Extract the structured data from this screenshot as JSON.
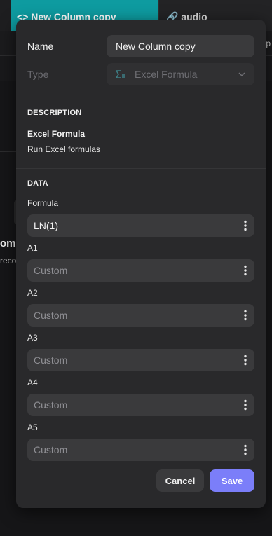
{
  "background": {
    "active_tab": "New Column copy",
    "second_tab": "audio",
    "row_edge_text": "p",
    "peek_title": "om",
    "peek_subtitle": "reco"
  },
  "dialog": {
    "name_label": "Name",
    "name_value": "New Column copy",
    "type_label": "Type",
    "type_value": "Excel Formula",
    "type_icon": "formula-icon",
    "description_heading": "DESCRIPTION",
    "description_title": "Excel Formula",
    "description_text": "Run Excel formulas",
    "data_heading": "DATA",
    "params": [
      {
        "label": "Formula",
        "value": "LN(1)",
        "placeholder": ""
      },
      {
        "label": "A1",
        "value": "",
        "placeholder": "Custom"
      },
      {
        "label": "A2",
        "value": "",
        "placeholder": "Custom"
      },
      {
        "label": "A3",
        "value": "",
        "placeholder": "Custom"
      },
      {
        "label": "A4",
        "value": "",
        "placeholder": "Custom"
      },
      {
        "label": "A5",
        "value": "",
        "placeholder": "Custom"
      }
    ],
    "cancel_label": "Cancel",
    "save_label": "Save"
  },
  "colors": {
    "accent_tab": "#0e9ba0",
    "save_button": "#7b7ef9",
    "dialog_bg": "#29292b"
  }
}
